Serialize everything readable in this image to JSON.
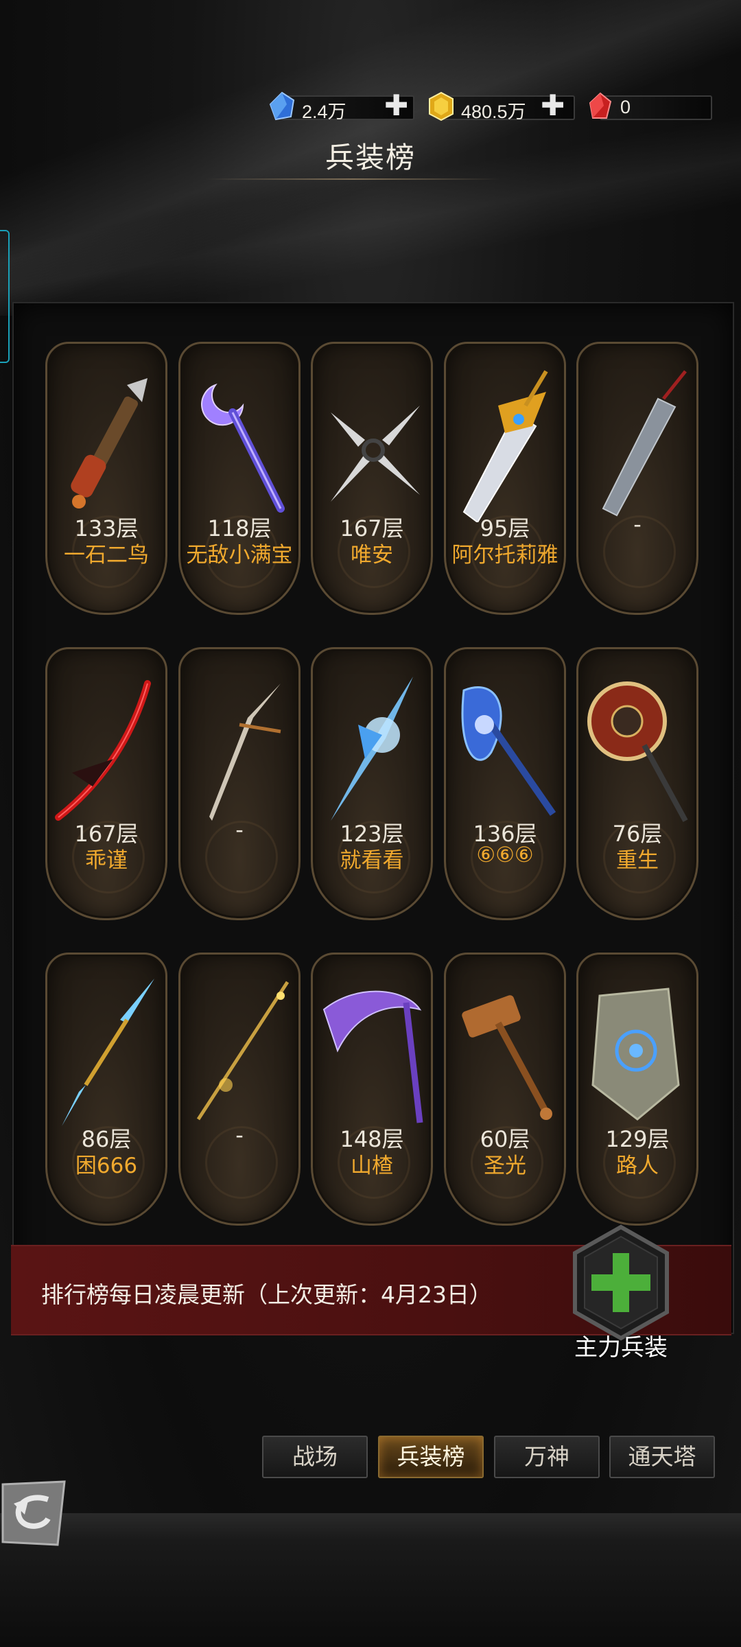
{
  "currencies": [
    {
      "icon": "blue-crystal-icon",
      "value": "2.4万",
      "color": "#3b7fe0"
    },
    {
      "icon": "gold-crystal-icon",
      "value": "480.5万",
      "color": "#e8b020"
    },
    {
      "icon": "red-crystal-icon",
      "value": "0",
      "color": "#d02a2a"
    }
  ],
  "title": "兵装榜",
  "cards": [
    {
      "weapon": "axe-rifle-icon",
      "floor": "133层",
      "owner": "一石二鸟"
    },
    {
      "weapon": "crescent-staff-icon",
      "floor": "118层",
      "owner": "无敌小满宝"
    },
    {
      "weapon": "cross-blades-icon",
      "floor": "167层",
      "owner": "唯安"
    },
    {
      "weapon": "winged-greatsword-icon",
      "floor": "95层",
      "owner": "阿尔托莉雅"
    },
    {
      "weapon": "broadsword-icon",
      "floor": "-",
      "owner": ""
    },
    {
      "weapon": "crimson-katana-icon",
      "floor": "167层",
      "owner": "乖谨"
    },
    {
      "weapon": "curved-sword-icon",
      "floor": "-",
      "owner": ""
    },
    {
      "weapon": "ice-crystal-spear-icon",
      "floor": "123层",
      "owner": "就看看"
    },
    {
      "weapon": "blue-flame-axe-icon",
      "floor": "136层",
      "owner": "⑥⑥⑥"
    },
    {
      "weapon": "sun-mace-icon",
      "floor": "76层",
      "owner": "重生"
    },
    {
      "weapon": "lightning-spear-icon",
      "floor": "86层",
      "owner": "困666"
    },
    {
      "weapon": "golden-spear-icon",
      "floor": "-",
      "owner": ""
    },
    {
      "weapon": "purple-scythe-icon",
      "floor": "148层",
      "owner": "山楂"
    },
    {
      "weapon": "bronze-hammer-icon",
      "floor": "60层",
      "owner": "圣光"
    },
    {
      "weapon": "stone-shield-icon",
      "floor": "129层",
      "owner": "路人"
    }
  ],
  "notice": "排行榜每日凌晨更新（上次更新：4月23日）",
  "main_weapon_label": "主力兵装",
  "tabs": [
    {
      "label": "战场",
      "active": false
    },
    {
      "label": "兵装榜",
      "active": true
    },
    {
      "label": "万神",
      "active": false
    },
    {
      "label": "通天塔",
      "active": false
    }
  ],
  "colors": {
    "owner_name": "#f0a92e",
    "notice_bg": "#5a1414",
    "add_green": "#4caf3a"
  }
}
